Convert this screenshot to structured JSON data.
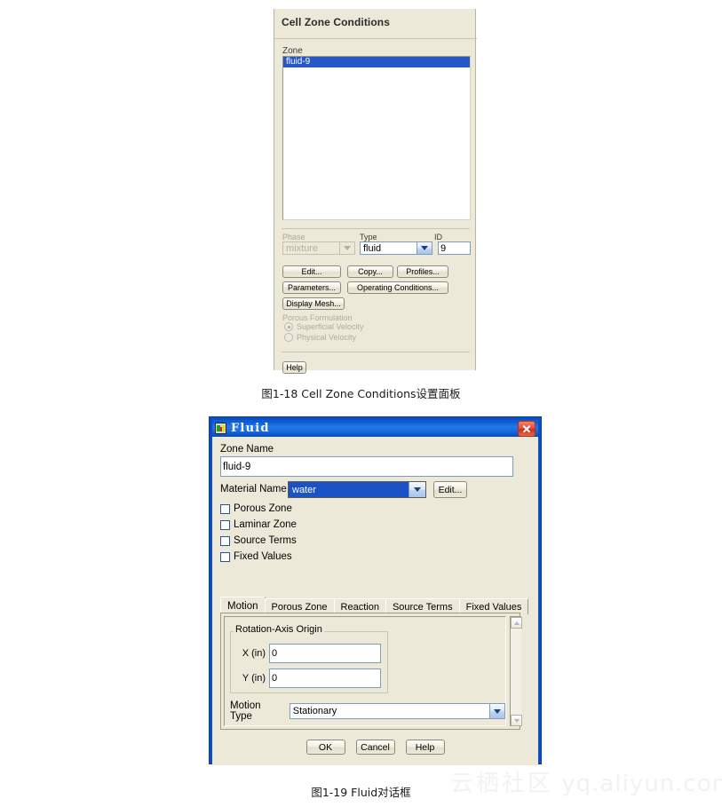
{
  "figure1": {
    "panel_title": "Cell Zone Conditions",
    "zone_label": "Zone",
    "zone_items": [
      "fluid-9"
    ],
    "selected_zone": "fluid-9",
    "phase_label": "Phase",
    "phase_value": "mixture",
    "type_label": "Type",
    "type_value": "fluid",
    "id_label": "ID",
    "id_value": "9",
    "buttons": [
      {
        "label": "Edit...",
        "name": "edit-button"
      },
      {
        "label": "Copy...",
        "name": "copy-button"
      },
      {
        "label": "Profiles...",
        "name": "profiles-button"
      },
      {
        "label": "Parameters...",
        "name": "parameters-button"
      },
      {
        "label": "Operating Conditions...",
        "name": "operating-conditions-button"
      },
      {
        "label": "Display Mesh...",
        "name": "display-mesh-button"
      }
    ],
    "porous_formulation_label": "Porous Formulation",
    "porous_options": [
      {
        "label": "Superficial Velocity",
        "selected": true
      },
      {
        "label": "Physical Velocity",
        "selected": false
      }
    ],
    "help_label": "Help"
  },
  "caption1": "图1-18 Cell Zone Conditions设置面板",
  "figure2": {
    "window_title": "Fluid",
    "close_icon": "close-icon",
    "zone_name_label": "Zone Name",
    "zone_name_value": "fluid-9",
    "material_name_label": "Material Name",
    "material_name_value": "water",
    "material_edit_label": "Edit...",
    "checkboxes": [
      {
        "label": "Porous Zone",
        "checked": false
      },
      {
        "label": "Laminar Zone",
        "checked": false
      },
      {
        "label": "Source Terms",
        "checked": false
      },
      {
        "label": "Fixed Values",
        "checked": false
      }
    ],
    "tabs": [
      {
        "label": "Motion",
        "active": true
      },
      {
        "label": "Porous Zone",
        "active": false
      },
      {
        "label": "Reaction",
        "active": false
      },
      {
        "label": "Source Terms",
        "active": false
      },
      {
        "label": "Fixed Values",
        "active": false
      }
    ],
    "group_label": "Rotation-Axis Origin",
    "axis_fields": [
      {
        "label": "X (in)",
        "value": "0"
      },
      {
        "label": "Y (in)",
        "value": "0"
      }
    ],
    "motion_type_label": "Motion Type",
    "motion_type_value": "Stationary",
    "dialog_buttons": [
      {
        "label": "OK",
        "name": "ok-button"
      },
      {
        "label": "Cancel",
        "name": "cancel-button"
      },
      {
        "label": "Help",
        "name": "help-button"
      }
    ]
  },
  "caption2": "图1-19 Fluid对话框",
  "watermark": {
    "cn": "云栖社区",
    "url": "yq.aliyun.com"
  },
  "colors": {
    "xp_face": "#ece9d8",
    "selection_blue": "#2558c6",
    "titlebar_blue": "#1b6fe0",
    "close_red": "#cc2e19"
  }
}
